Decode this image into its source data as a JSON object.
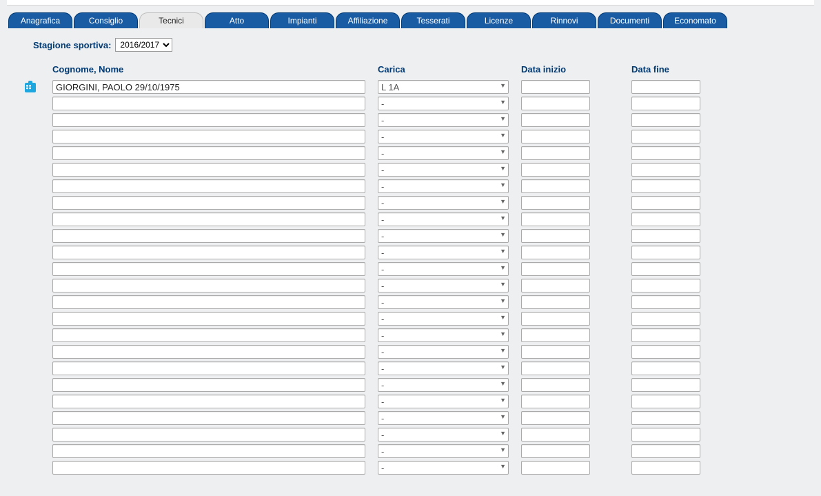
{
  "tabs": [
    {
      "label": "Anagrafica",
      "active": false
    },
    {
      "label": "Consiglio",
      "active": false
    },
    {
      "label": "Tecnici",
      "active": true
    },
    {
      "label": "Atto",
      "active": false
    },
    {
      "label": "Impianti",
      "active": false
    },
    {
      "label": "Affiliazione",
      "active": false
    },
    {
      "label": "Tesserati",
      "active": false
    },
    {
      "label": "Licenze",
      "active": false
    },
    {
      "label": "Rinnovi",
      "active": false
    },
    {
      "label": "Documenti",
      "active": false
    },
    {
      "label": "Economato",
      "active": false
    }
  ],
  "season": {
    "label": "Stagione sportiva:",
    "selected": "2016/2017",
    "options": [
      "2016/2017"
    ]
  },
  "columns": {
    "name": "Cognome, Nome",
    "role": "Carica",
    "start": "Data inizio",
    "end": "Data fine"
  },
  "role_options": [
    "-",
    "L 1A"
  ],
  "rows": [
    {
      "name": "GIORGINI, PAOLO 29/10/1975",
      "role": "L 1A",
      "start": "",
      "end": "",
      "badge": true
    },
    {
      "name": "",
      "role": "-",
      "start": "",
      "end": "",
      "badge": false
    },
    {
      "name": "",
      "role": "-",
      "start": "",
      "end": "",
      "badge": false
    },
    {
      "name": "",
      "role": "-",
      "start": "",
      "end": "",
      "badge": false
    },
    {
      "name": "",
      "role": "-",
      "start": "",
      "end": "",
      "badge": false
    },
    {
      "name": "",
      "role": "-",
      "start": "",
      "end": "",
      "badge": false
    },
    {
      "name": "",
      "role": "-",
      "start": "",
      "end": "",
      "badge": false
    },
    {
      "name": "",
      "role": "-",
      "start": "",
      "end": "",
      "badge": false
    },
    {
      "name": "",
      "role": "-",
      "start": "",
      "end": "",
      "badge": false
    },
    {
      "name": "",
      "role": "-",
      "start": "",
      "end": "",
      "badge": false
    },
    {
      "name": "",
      "role": "-",
      "start": "",
      "end": "",
      "badge": false
    },
    {
      "name": "",
      "role": "-",
      "start": "",
      "end": "",
      "badge": false
    },
    {
      "name": "",
      "role": "-",
      "start": "",
      "end": "",
      "badge": false
    },
    {
      "name": "",
      "role": "-",
      "start": "",
      "end": "",
      "badge": false
    },
    {
      "name": "",
      "role": "-",
      "start": "",
      "end": "",
      "badge": false
    },
    {
      "name": "",
      "role": "-",
      "start": "",
      "end": "",
      "badge": false
    },
    {
      "name": "",
      "role": "-",
      "start": "",
      "end": "",
      "badge": false
    },
    {
      "name": "",
      "role": "-",
      "start": "",
      "end": "",
      "badge": false
    },
    {
      "name": "",
      "role": "-",
      "start": "",
      "end": "",
      "badge": false
    },
    {
      "name": "",
      "role": "-",
      "start": "",
      "end": "",
      "badge": false
    },
    {
      "name": "",
      "role": "-",
      "start": "",
      "end": "",
      "badge": false
    },
    {
      "name": "",
      "role": "-",
      "start": "",
      "end": "",
      "badge": false
    },
    {
      "name": "",
      "role": "-",
      "start": "",
      "end": "",
      "badge": false
    },
    {
      "name": "",
      "role": "-",
      "start": "",
      "end": "",
      "badge": false
    }
  ]
}
